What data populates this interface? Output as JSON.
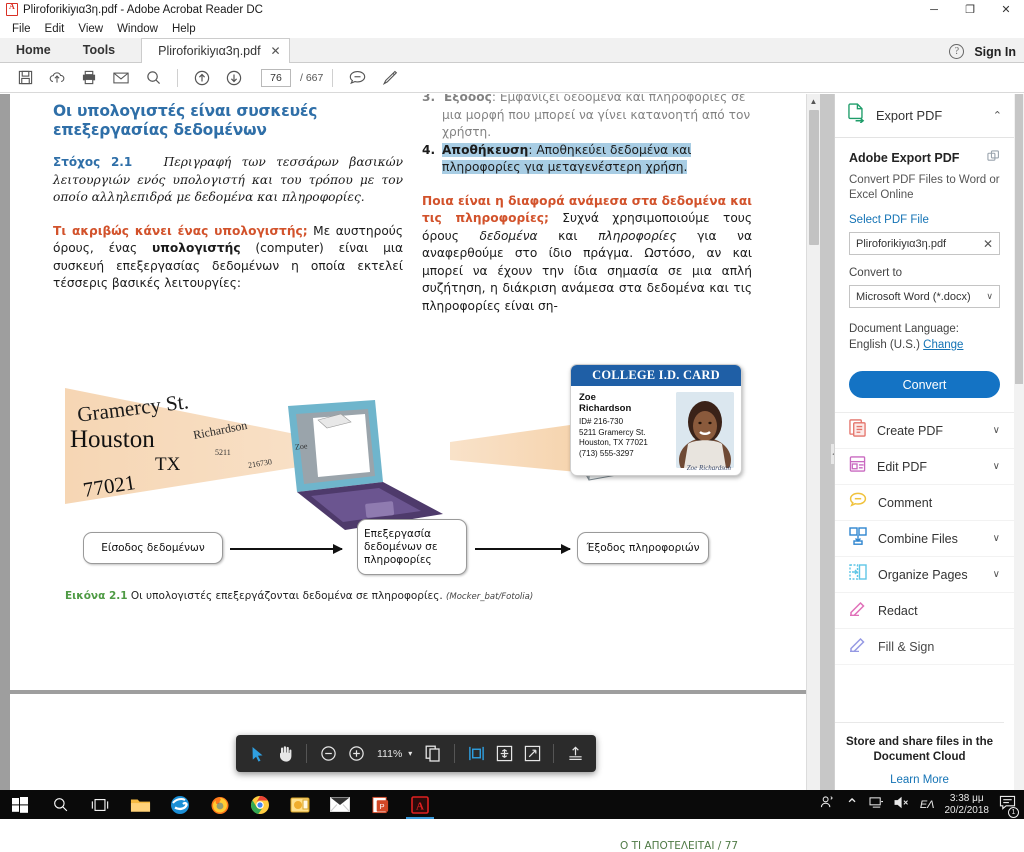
{
  "window": {
    "title": "Pliroforikiyια3η.pdf - Adobe Acrobat Reader DC",
    "minimize": "─",
    "maximize": "❐",
    "close": "✕"
  },
  "menubar": {
    "items": [
      "File",
      "Edit",
      "View",
      "Window",
      "Help"
    ]
  },
  "tabs": {
    "home": "Home",
    "tools": "Tools",
    "document": "Pliroforikiyια3η.pdf",
    "close": "✕",
    "help": "?",
    "sign_in": "Sign In"
  },
  "toolbar": {
    "save": "save-icon",
    "upload": "upload-cloud-icon",
    "print": "print-icon",
    "email": "email-icon",
    "search": "search-icon",
    "prev_page": "arrow-up-circle-icon",
    "next_page": "arrow-down-circle-icon",
    "page_value": "76",
    "page_total": "/ 667",
    "comment": "comment-icon",
    "highlight": "highlight-pen-icon"
  },
  "document": {
    "heading": "Οι υπολογιστές είναι συσκευές επεξεργασίας δεδομένων",
    "objective_label": "Στόχος 2.1",
    "objective_text": "Περιγραφή των τεσσάρων βασικών λειτουργιών ενός υπολογιστή και του τρόπου με τον οποίο αλληλεπιδρά με δεδομένα και πληροφορίες.",
    "q1_bold": "Τι ακριβώς κάνει ένας υπολογιστής;",
    "q1_rest_a": " Με αυστηρούς όρους, ένας ",
    "q1_strong": "υπολογιστής",
    "q1_rest_b": " (computer) είναι μια συσκευή επεξεργασίας δεδομένων η οποία εκτελεί τέσσερις βασικές λειτουργίες:",
    "list_item3_num": "3.",
    "list_item3_bold": "Έξοδος",
    "list_item3_text": ": Εμφανίζει δεδομένα και πληροφορίες σε μια μορφή που μπορεί να γίνει κατανοητή από τον χρήστη.",
    "list_item4_num": "4.",
    "list_item4_bold": "Αποθήκευση",
    "list_item4_text": ": Αποθηκεύει δεδομένα και πληροφορίες για μεταγενέστερη χρήση.",
    "q2_bold": "Ποια είναι η διαφορά ανάμεσα στα δεδομένα και τις πληροφορίες;",
    "q2_rest_a": " Συχνά χρησιμοποιούμε τους όρους ",
    "q2_it1": "δεδομένα",
    "q2_rest_b": " και ",
    "q2_it2": "πληροφορίες",
    "q2_rest_c": " για να αναφερθούμε στο ίδιο πράγμα. Ωστόσο, αν και μπορεί να έχουν την ίδια σημασία σε μια απλή συζήτηση, η διάκριση ανάμεσα στα δεδομένα και τις πληροφορίες είναι ση-"
  },
  "figure": {
    "id_card": {
      "header": "COLLEGE I.D. CARD",
      "name_line1": "Zoe",
      "name_line2": "Richardson",
      "id": "ID# 216-730",
      "address1": "5211 Gramercy St.",
      "address2": "Houston, TX 77021",
      "phone": "(713) 555-3297"
    },
    "beam_words": [
      "Gramercy St.",
      "Richardson",
      "Houston",
      "TX",
      "77021",
      "5211",
      "216730",
      "Zoe"
    ],
    "flow": [
      "Είσοδος δεδομένων",
      "Επεξεργασία δεδομένων σε πληροφορίες",
      "Έξοδος πληροφοριών"
    ],
    "caption_label": "Εικόνα 2.1",
    "caption_text": "Οι υπολογιστές επεξεργάζονται δεδομένα σε πληροφορίες.",
    "caption_credit": "(Mocker_bat/Fotolia)"
  },
  "right_panel": {
    "header": {
      "title": "Export PDF",
      "icon": "export-pdf-icon",
      "chevron": "⌃"
    },
    "export": {
      "title": "Adobe Export PDF",
      "switch_icon": "switch-account-icon",
      "subtitle": "Convert PDF Files to Word or Excel Online",
      "select_label": "Select PDF File",
      "file_value": "Pliroforikiyια3η.pdf",
      "file_clear": "✕",
      "convert_to_label": "Convert to",
      "convert_to_value": "Microsoft Word (*.docx)",
      "chevron": "∨",
      "doc_lang_label": "Document Language:",
      "doc_lang_value": "English (U.S.)",
      "doc_lang_change": "Change",
      "convert_button": "Convert"
    },
    "tools": [
      {
        "label": "Create PDF",
        "icon": "create-pdf-icon",
        "chevron": "∨",
        "color": "#e4736a"
      },
      {
        "label": "Edit PDF",
        "icon": "edit-pdf-icon",
        "chevron": "∨",
        "color": "#c969c0"
      },
      {
        "label": "Comment",
        "icon": "comment-icon",
        "chevron": "",
        "color": "#f0c23c"
      },
      {
        "label": "Combine Files",
        "icon": "combine-files-icon",
        "chevron": "∨",
        "color": "#2f86d0"
      },
      {
        "label": "Organize Pages",
        "icon": "organize-pages-icon",
        "chevron": "∨",
        "color": "#5fc6e6"
      },
      {
        "label": "Redact",
        "icon": "redact-icon",
        "chevron": "",
        "color": "#e06fb8"
      },
      {
        "label": "Fill & Sign",
        "icon": "fill-sign-icon",
        "chevron": "",
        "color": "#8a8ee0"
      }
    ],
    "footer": {
      "line1": "Store and share files in the",
      "line2": "Document Cloud",
      "link": "Learn More"
    }
  },
  "float_toolbar": {
    "select": "cursor-select-icon",
    "hand": "hand-pan-icon",
    "zoom_out": "zoom-out-icon",
    "zoom_in": "zoom-in-icon",
    "zoom_value": "111%",
    "zoom_chevron": "▾",
    "page_layout": "page-layout-icon",
    "fit_width": "fit-width-icon",
    "fit_page": "fit-page-icon",
    "fullscreen": "fullscreen-icon",
    "share": "share-icon"
  },
  "page_footer": {
    "text": "Ο ΤΙ ΑΠΟΤΕΛΕΙΤΑΙ",
    "sep": "/",
    "number": "77"
  },
  "taskbar": {
    "start": "windows-start-icon",
    "search": "search-icon",
    "taskview": "task-view-icon",
    "apps": [
      "file-explorer-icon",
      "internet-explorer-icon",
      "firefox-icon",
      "chrome-icon",
      "outlook-icon",
      "mail-icon",
      "powerpoint-icon",
      "acrobat-reader-icon"
    ],
    "tray": {
      "people": "people-icon",
      "chevron": "⌃",
      "network": "network-icon",
      "volume": "volume-muted-icon",
      "language": "ΕΛ",
      "time": "3:38 μμ",
      "date": "20/2/2018",
      "notifications": "notification-icon",
      "notification_count": "1"
    }
  }
}
